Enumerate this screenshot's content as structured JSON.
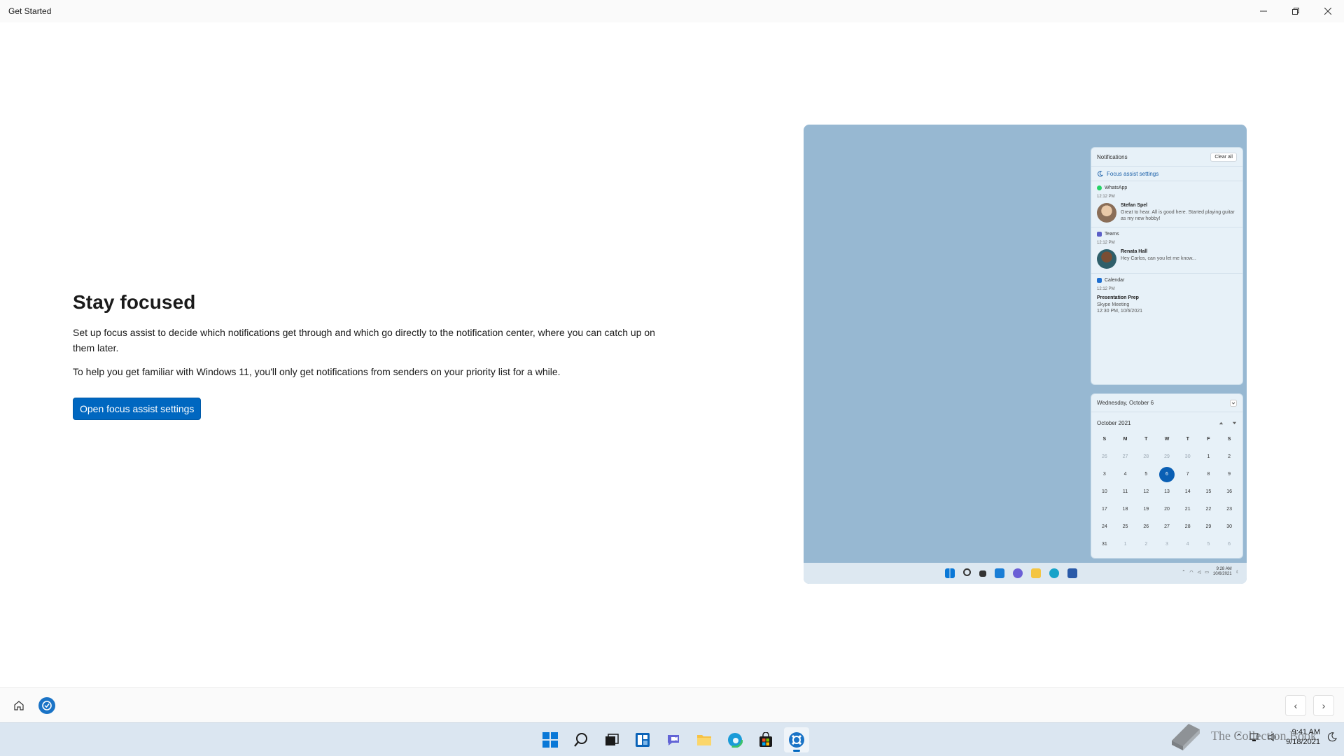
{
  "window": {
    "title": "Get Started",
    "controls": {
      "minimize": "—",
      "restore": "❐",
      "close": "✕"
    }
  },
  "main": {
    "title": "Stay focused",
    "paragraph1": "Set up focus assist to decide which notifications get through and which go directly to the notification center, where you can catch up on them later.",
    "paragraph2": "To help you get familiar with Windows 11, you'll only get notifications from senders on your priority list for a while.",
    "button_label": "Open focus assist settings"
  },
  "illustration": {
    "notifications": {
      "header": "Notifications",
      "clear_all": "Clear all",
      "focus_link": "Focus assist settings",
      "groups": [
        {
          "app": "WhatsApp",
          "time": "12:12 PM",
          "sender": "Stefan Spel",
          "message": "Great to hear. All is good here. Started playing guitar as my new hobby!",
          "color": "#25d366"
        },
        {
          "app": "Teams",
          "time": "12:12 PM",
          "sender": "Renata Hall",
          "message": "Hey Carlos, can you let me know...",
          "color": "#5b5fc7"
        },
        {
          "app": "Calendar",
          "time": "12:12 PM",
          "sender": "Presentation Prep",
          "message": "Skype Meeting",
          "message2": "12:30 PM, 10/6/2021",
          "color": "#1e6fd0"
        }
      ]
    },
    "calendar": {
      "date_header": "Wednesday, October 6",
      "month": "October 2021",
      "weekdays": [
        "S",
        "M",
        "T",
        "W",
        "T",
        "F",
        "S"
      ],
      "days": [
        "26",
        "27",
        "28",
        "29",
        "30",
        "1",
        "2",
        "3",
        "4",
        "5",
        "6",
        "7",
        "8",
        "9",
        "10",
        "11",
        "12",
        "13",
        "14",
        "15",
        "16",
        "17",
        "18",
        "19",
        "20",
        "21",
        "22",
        "23",
        "24",
        "25",
        "26",
        "27",
        "28",
        "29",
        "30",
        "31",
        "1",
        "2",
        "3",
        "4",
        "5",
        "6"
      ],
      "today_index": 10,
      "dim_indices": [
        0,
        1,
        2,
        3,
        4,
        36,
        37,
        38,
        39,
        40,
        41
      ]
    },
    "mini_clock": {
      "time": "9:28 AM",
      "date": "10/6/2021"
    }
  },
  "appbar": {
    "prev": "‹",
    "next": "›"
  },
  "taskbar": {
    "clock_time": "9:41 AM",
    "clock_date": "9/18/2021"
  },
  "watermark": "The Collection Book",
  "colors": {
    "accent": "#0067c0",
    "illustration_bg": "#97b8d2",
    "taskbar_bg": "#dbe6f1"
  }
}
